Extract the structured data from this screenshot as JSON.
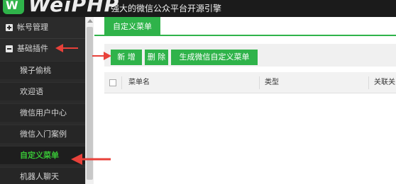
{
  "header": {
    "logo_badge": "W",
    "logo_text": "WeiPHP",
    "tagline": "强大的微信公众平台开源引擎"
  },
  "sidebar": {
    "groups": [
      {
        "label": "帐号管理",
        "icon": "plus-box-icon",
        "expanded": false
      },
      {
        "label": "基础插件",
        "icon": "minus-box-icon",
        "expanded": true
      }
    ],
    "items": [
      {
        "label": "猴子偷桃"
      },
      {
        "label": "欢迎语"
      },
      {
        "label": "微信用户中心"
      },
      {
        "label": "微信入门案例"
      },
      {
        "label": "自定义菜单",
        "active": true
      },
      {
        "label": "机器人聊天"
      }
    ]
  },
  "main": {
    "tab": "自定义菜单",
    "toolbar": {
      "new_label": "新 增",
      "delete_label": "删 除",
      "generate_label": "生成微信自定义菜单"
    },
    "table": {
      "columns": [
        "菜单名",
        "类型",
        "关联关"
      ]
    }
  },
  "colors": {
    "accent_green": "#2fb34a",
    "active_text_green": "#38c636",
    "sidebar_bg": "#2b2b2b",
    "header_bg": "#1b1b1b",
    "arrow_red": "#e8413a"
  }
}
